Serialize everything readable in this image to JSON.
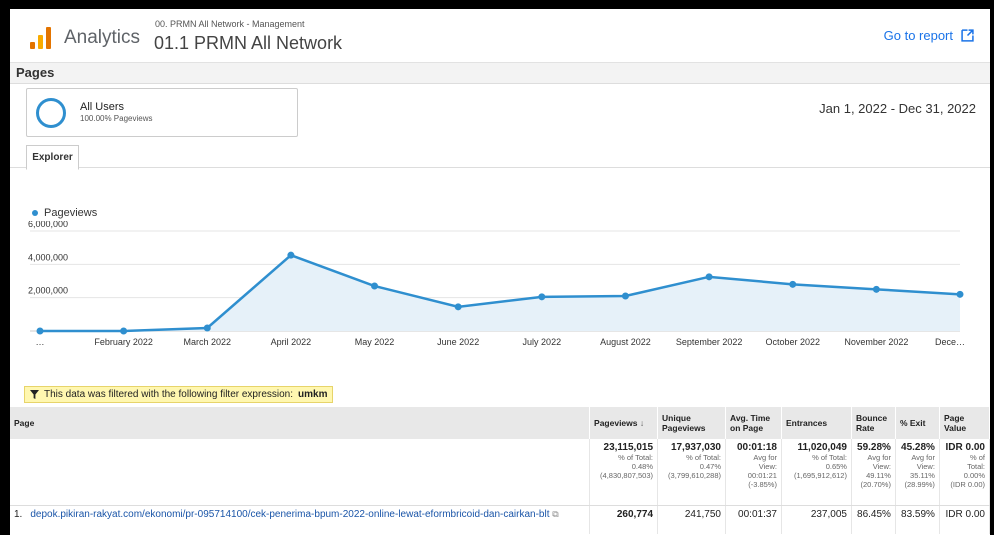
{
  "header": {
    "app_name": "Analytics",
    "account_path": "00. PRMN All Network - Management",
    "view_name": "01.1 PRMN All Network",
    "go_to_report": "Go to report"
  },
  "page_title": "Pages",
  "segment": {
    "name": "All Users",
    "sub": "100.00% Pageviews"
  },
  "date_range": "Jan 1, 2022 - Dec 31, 2022",
  "tab": "Explorer",
  "chart_data": {
    "type": "area",
    "series": [
      {
        "name": "Pageviews",
        "values": [
          0,
          0,
          180000,
          4550000,
          2700000,
          1450000,
          2050000,
          2100000,
          3250000,
          2800000,
          2500000,
          2200000
        ]
      }
    ],
    "x": [
      "…",
      "February 2022",
      "March 2022",
      "April 2022",
      "May 2022",
      "June 2022",
      "July 2022",
      "August 2022",
      "September 2022",
      "October 2022",
      "November 2022",
      "Dece…"
    ],
    "y_ticks": [
      "6,000,000",
      "4,000,000",
      "2,000,000"
    ],
    "ylim": [
      0,
      6000000
    ],
    "color": "#2f8fcf",
    "legend": "top-left",
    "grid": true
  },
  "filter": {
    "text": "This data was filtered with the following filter expression:",
    "expr": "umkm"
  },
  "table": {
    "headers": [
      "Page",
      "Pageviews",
      "Unique Pageviews",
      "Avg. Time on Page",
      "Entrances",
      "Bounce Rate",
      "% Exit",
      "Page Value"
    ],
    "sort_arrow": "↓",
    "totals": [
      {
        "v": "23,115,015",
        "l1": "% of Total:",
        "l2": "0.48%",
        "l3": "(4,830,807,503)"
      },
      {
        "v": "17,937,030",
        "l1": "% of Total:",
        "l2": "0.47%",
        "l3": "(3,799,610,288)"
      },
      {
        "v": "00:01:18",
        "l1": "Avg for",
        "l2": "View:",
        "l3": "00:01:21",
        "l4": "(-3.85%)"
      },
      {
        "v": "11,020,049",
        "l1": "% of Total:",
        "l2": "0.65%",
        "l3": "(1,695,912,612)"
      },
      {
        "v": "59.28%",
        "l1": "Avg for",
        "l2": "View:",
        "l3": "49.11%",
        "l4": "(20.70%)"
      },
      {
        "v": "45.28%",
        "l1": "Avg for",
        "l2": "View:",
        "l3": "35.11%",
        "l4": "(28.99%)"
      },
      {
        "v": "IDR 0.00",
        "l1": "% of",
        "l2": "Total:",
        "l3": "0.00%",
        "l4": "(IDR 0.00)"
      }
    ],
    "rows": [
      {
        "idx": "1.",
        "page": "depok.pikiran-rakyat.com/ekonomi/pr-095714100/cek-penerima-bpum-2022-online-lewat-eformbricoid-dan-cairkan-blt",
        "pageviews": "260,774",
        "unique": "241,750",
        "avg_time": "00:01:37",
        "entrances": "237,005",
        "bounce": "86.45%",
        "exit": "83.59%",
        "value": "IDR 0.00"
      }
    ]
  }
}
